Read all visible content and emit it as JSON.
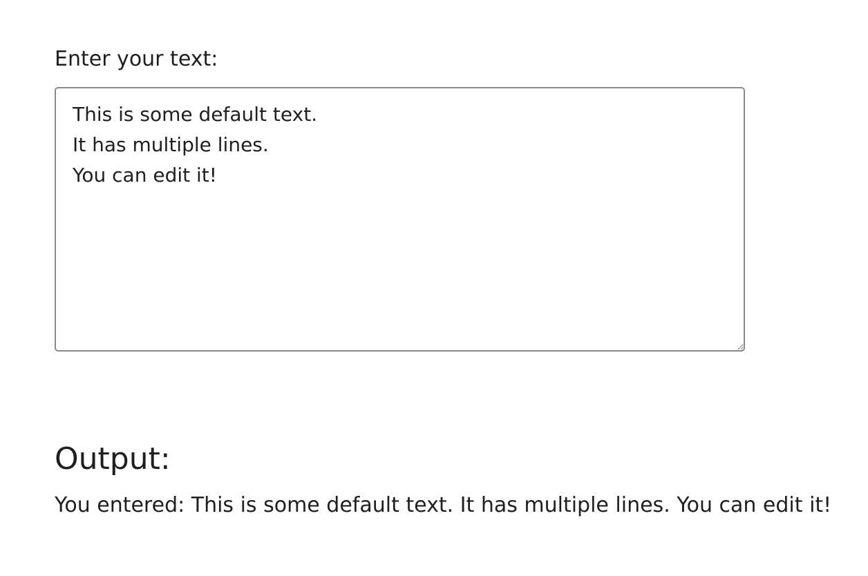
{
  "form": {
    "label": "Enter your text:",
    "textarea_value": "This is some default text.\nIt has multiple lines.\nYou can edit it!"
  },
  "output": {
    "heading": "Output:",
    "text": "You entered: This is some default text. It has multiple lines. You can edit it!"
  }
}
